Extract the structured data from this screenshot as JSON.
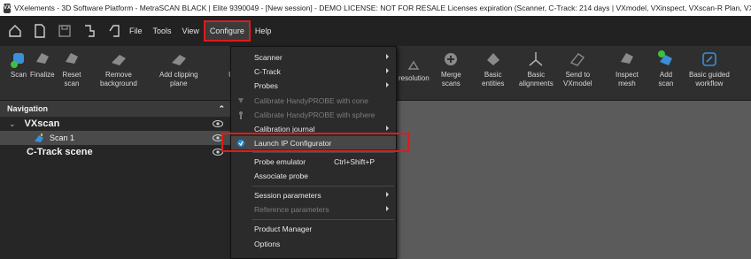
{
  "window": {
    "title": "VXelements - 3D Software Platform - MetraSCAN BLACK | Elite 9390049 - [New session] - DEMO LICENSE: NOT FOR RESALE Licenses expiration (Scanner, C-Track: 214 days | VXmodel, VXinspect, VXscan-R Plan, VXscan-R"
  },
  "menubar": {
    "items": [
      "File",
      "Tools",
      "View",
      "Configure",
      "Help"
    ]
  },
  "ribbon": {
    "left": [
      {
        "label": "Scan",
        "icon": "scan-icon"
      },
      {
        "label": "Finalize",
        "icon": "finalize-icon"
      },
      {
        "label": "Reset\nscan",
        "icon": "reset-scan-icon"
      },
      {
        "label": "Remove\nbackground",
        "icon": "remove-background-icon"
      },
      {
        "label": "Add clipping\nplane",
        "icon": "clipping-plane-icon"
      },
      {
        "label": "U",
        "icon": "partial-icon"
      }
    ],
    "right": [
      {
        "label": "resolution",
        "icon": "resolution-icon"
      },
      {
        "label": "Merge\nscans",
        "icon": "merge-scans-icon"
      },
      {
        "label": "Basic\nentities",
        "icon": "basic-entities-icon"
      },
      {
        "label": "Basic\nalignments",
        "icon": "basic-alignments-icon"
      },
      {
        "label": "Send to\nVXmodel",
        "icon": "send-to-vxmodel-icon"
      },
      {
        "label": "Inspect\nmesh",
        "icon": "inspect-mesh-icon"
      },
      {
        "label": "Add\nscan",
        "icon": "add-scan-icon"
      },
      {
        "label": "Basic guided\nworkflow",
        "icon": "guided-workflow-icon"
      }
    ]
  },
  "navigation": {
    "header": "Navigation",
    "tree": [
      {
        "label": "VXscan",
        "level": 0
      },
      {
        "label": "Scan 1",
        "level": 1
      },
      {
        "label": "C-Track scene",
        "level": 0
      }
    ]
  },
  "configure_menu": {
    "items": [
      {
        "label": "Scanner",
        "submenu": true,
        "disabled": false
      },
      {
        "label": "C-Track",
        "submenu": true,
        "disabled": false
      },
      {
        "label": "Probes",
        "submenu": true,
        "disabled": false
      },
      {
        "label": "Calibrate HandyPROBE with cone",
        "submenu": false,
        "disabled": true
      },
      {
        "label": "Calibrate HandyPROBE with sphere",
        "submenu": false,
        "disabled": true
      },
      {
        "label": "Calibration journal",
        "submenu": true,
        "disabled": false
      },
      {
        "label": "Launch IP Configurator",
        "submenu": false,
        "disabled": false
      },
      {
        "label": "Probe emulator",
        "shortcut": "Ctrl+Shift+P",
        "submenu": false,
        "disabled": false
      },
      {
        "label": "Associate probe",
        "submenu": false,
        "disabled": false
      },
      {
        "label": "Session parameters",
        "submenu": true,
        "disabled": false
      },
      {
        "label": "Reference parameters",
        "submenu": true,
        "disabled": true
      },
      {
        "label": "Product Manager",
        "submenu": false,
        "disabled": false
      },
      {
        "label": "Options",
        "submenu": false,
        "disabled": false
      }
    ]
  },
  "colors": {
    "highlight_box": "#e01b1b",
    "accent_blue": "#1e8fe0",
    "accent_green": "#3fbf3f"
  }
}
